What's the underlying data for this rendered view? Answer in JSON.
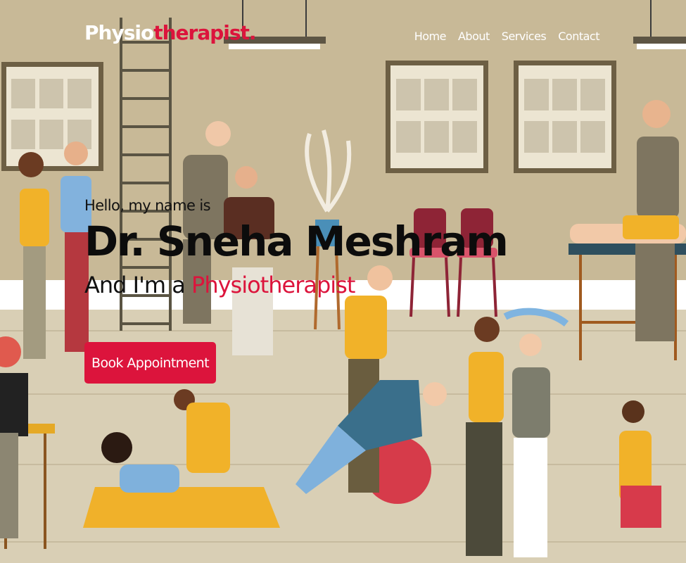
{
  "brand": {
    "part1": "Physio",
    "part2": "therapist."
  },
  "nav": {
    "items": [
      "Home",
      "About",
      "Services",
      "Contact"
    ]
  },
  "hero": {
    "greeting": "Hello, my name is",
    "name": "Dr. Sneha Meshram",
    "role_prefix": "And I'm a",
    "role": "Physiotherapist",
    "cta": "Book Appointment"
  },
  "colors": {
    "accent": "#dc143c",
    "background": "#d9cfb5"
  }
}
